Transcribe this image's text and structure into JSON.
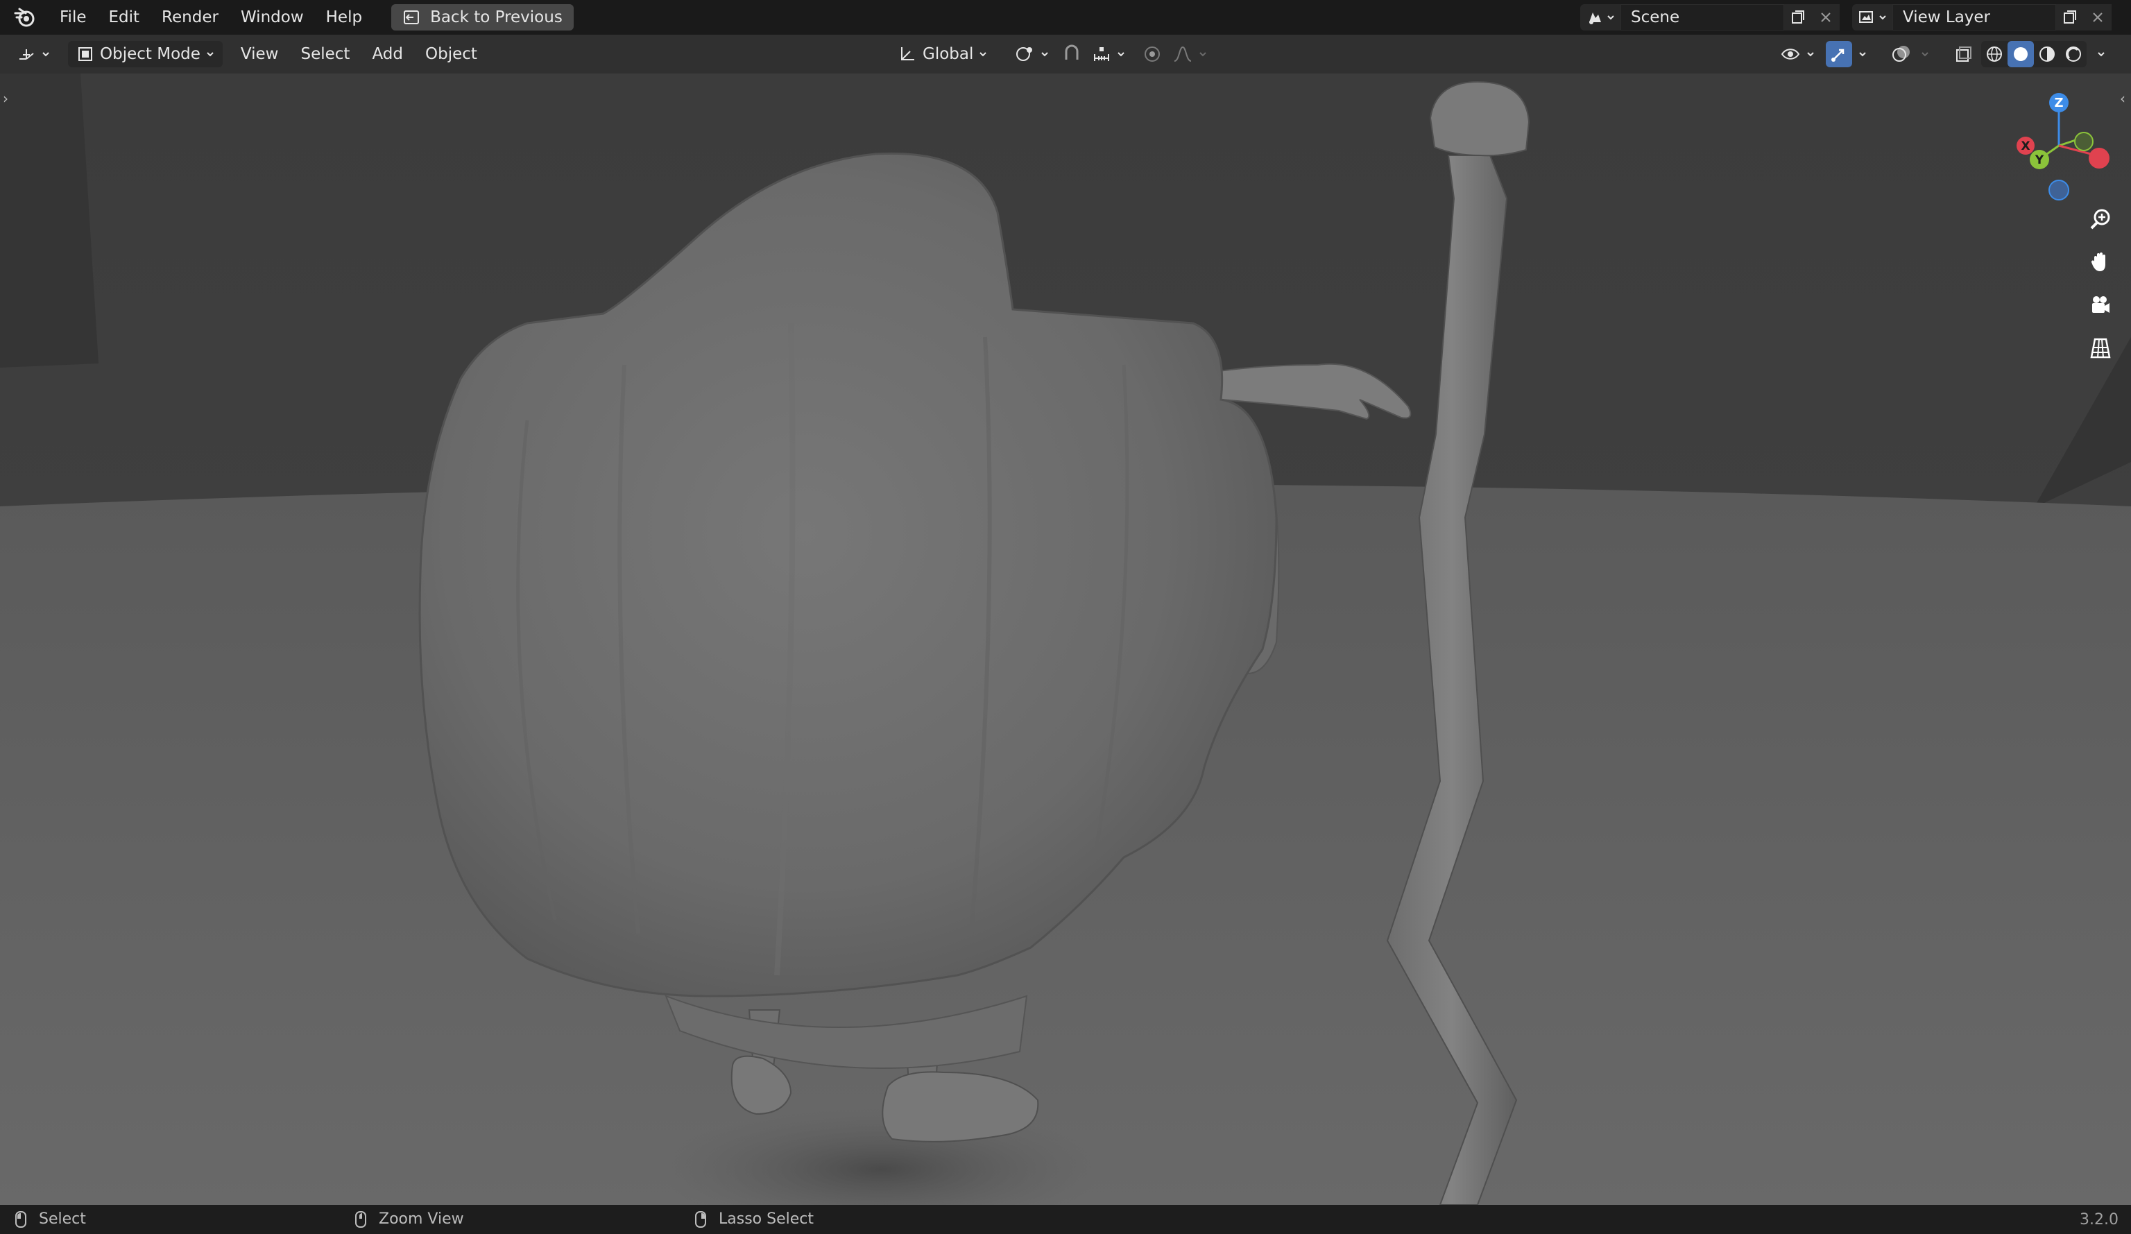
{
  "topbar": {
    "menus": [
      "File",
      "Edit",
      "Render",
      "Window",
      "Help"
    ],
    "back_label": "Back to Previous",
    "scene_name": "Scene",
    "view_layer_name": "View Layer"
  },
  "header": {
    "mode": "Object Mode",
    "menus": [
      "View",
      "Select",
      "Add",
      "Object"
    ],
    "transform_orientation": "Global"
  },
  "gizmo": {
    "z": "Z",
    "y": "Y",
    "x": "X"
  },
  "status": {
    "left": "Select",
    "middle": "Zoom View",
    "right": "Lasso Select",
    "version": "3.2.0"
  },
  "icons": [
    "blender-logo-icon",
    "back-icon",
    "scene-icon",
    "copy-icon",
    "close-icon",
    "view-layer-icon",
    "editor-type-icon",
    "object-mode-icon",
    "transform-orientation-icon",
    "pivot-icon",
    "snap-icon",
    "proportional-edit-icon",
    "visibility-icon",
    "gizmo-icon",
    "overlay-icon",
    "xray-icon",
    "wireframe-shading-icon",
    "solid-shading-icon",
    "material-shading-icon",
    "rendered-shading-icon",
    "zoom-icon",
    "hand-icon",
    "camera-icon",
    "grid-icon"
  ],
  "colors": {
    "accent": "#4772b3",
    "axis_x": "#e0424f",
    "axis_y": "#8bc33a",
    "axis_z": "#3d8ce8"
  }
}
